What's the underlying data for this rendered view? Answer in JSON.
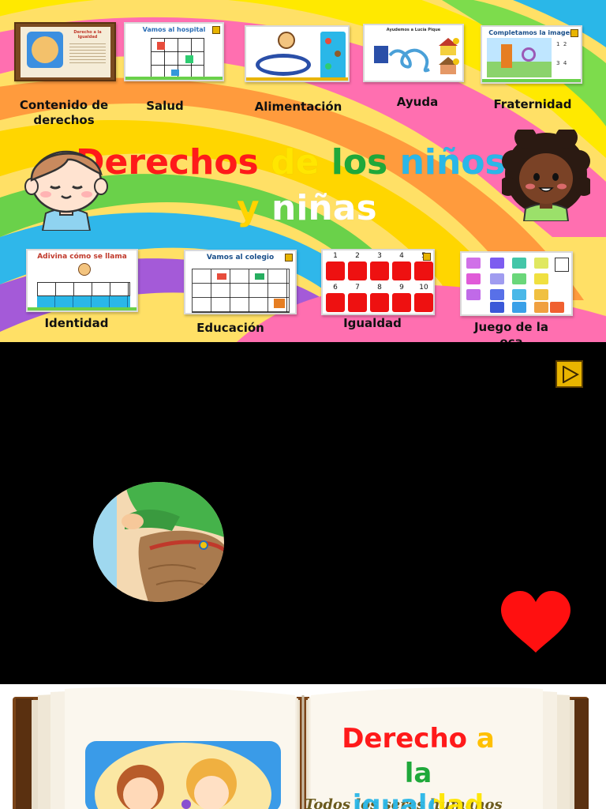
{
  "menu": {
    "topics_top": [
      {
        "label_line1": "Contenido de",
        "label_line2": "derechos",
        "thumb_title": "Derecho a la Igualdad"
      },
      {
        "label_line1": "Salud",
        "label_line2": "",
        "thumb_title": "Vamos al hospital"
      },
      {
        "label_line1": "Alimentación",
        "label_line2": "",
        "thumb_title": ""
      },
      {
        "label_line1": "Ayuda",
        "label_line2": "",
        "thumb_title": "Ayudemos a Lucía Pique"
      },
      {
        "label_line1": "Fraternidad",
        "label_line2": "",
        "thumb_title": "Completamos la imagen"
      }
    ],
    "topics_bottom": [
      {
        "label": "Identidad",
        "thumb_title": "Adivina cómo se llama"
      },
      {
        "label": "Educación",
        "thumb_title": "Vamos al colegio"
      },
      {
        "label": "Igualdad",
        "thumb_title": ""
      },
      {
        "label": "Juego de la oca",
        "thumb_title": ""
      }
    ],
    "title": {
      "w1": "Derechos",
      "w2": "de",
      "w3": "los",
      "w4": "niños",
      "w5": "y",
      "w6": "niñas"
    },
    "igualdad_numbers": [
      "1",
      "2",
      "3",
      "4",
      "5",
      "6",
      "7",
      "8",
      "9",
      "10"
    ]
  },
  "video": {
    "next_icon": "play-triangle-icon",
    "heart_icon": "heart-icon"
  },
  "book": {
    "title_w1": "Derecho",
    "title_w2": "a",
    "title_w3": "la",
    "title_w4": "igualdad",
    "subtitle": "Todos los seres humanos"
  },
  "colors": {
    "red": "#ff1a1a",
    "yellow": "#ffe600",
    "green": "#1fa83a",
    "cyan": "#2ab7e8",
    "white": "#ffffff",
    "gold": "#e8b400"
  }
}
